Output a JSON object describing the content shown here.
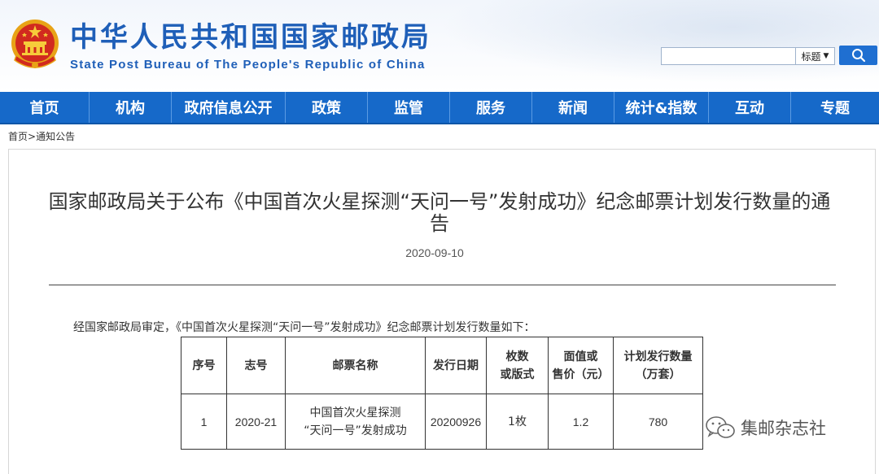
{
  "header": {
    "site_name_cn": "中华人民共和国国家邮政局",
    "site_name_en": "State Post Bureau of The People's Republic of China",
    "emblem_icon": "national-emblem-icon"
  },
  "search": {
    "input_value": "",
    "select_value": "标题",
    "search_icon": "search-icon"
  },
  "nav": {
    "items": [
      "首页",
      "机构",
      "政府信息公开",
      "政策",
      "监管",
      "服务",
      "新闻",
      "统计&指数",
      "互动",
      "专题"
    ]
  },
  "breadcrumb": {
    "home": "首页",
    "separator": ">",
    "current": "通知公告"
  },
  "article": {
    "title": "国家邮政局关于公布《中国首次火星探测“天问一号”发射成功》纪念邮票计划发行数量的通告",
    "date": "2020-09-10",
    "intro": "经国家邮政局审定，《中国首次火星探测“天问一号”发射成功》纪念邮票计划发行数量如下："
  },
  "table": {
    "headers": [
      [
        "序号"
      ],
      [
        "志号"
      ],
      [
        "邮票名称"
      ],
      [
        "发行日期"
      ],
      [
        "枚数",
        "或版式"
      ],
      [
        "面值或",
        "售价（元）"
      ],
      [
        "计划发行数量",
        "（万套）"
      ]
    ],
    "rows": [
      {
        "no": "1",
        "code": "2020-21",
        "name": [
          "中国首次火星探测",
          "“天问一号”发射成功"
        ],
        "date": "20200926",
        "count": "1枚",
        "price": "1.2",
        "quantity": "780"
      }
    ]
  },
  "watermark": {
    "text": "集邮杂志社",
    "icon": "wechat-icon"
  },
  "colors": {
    "brand_blue": "#1f5fb8",
    "nav_blue": "#1669c9",
    "search_button": "#1f6fd1"
  }
}
